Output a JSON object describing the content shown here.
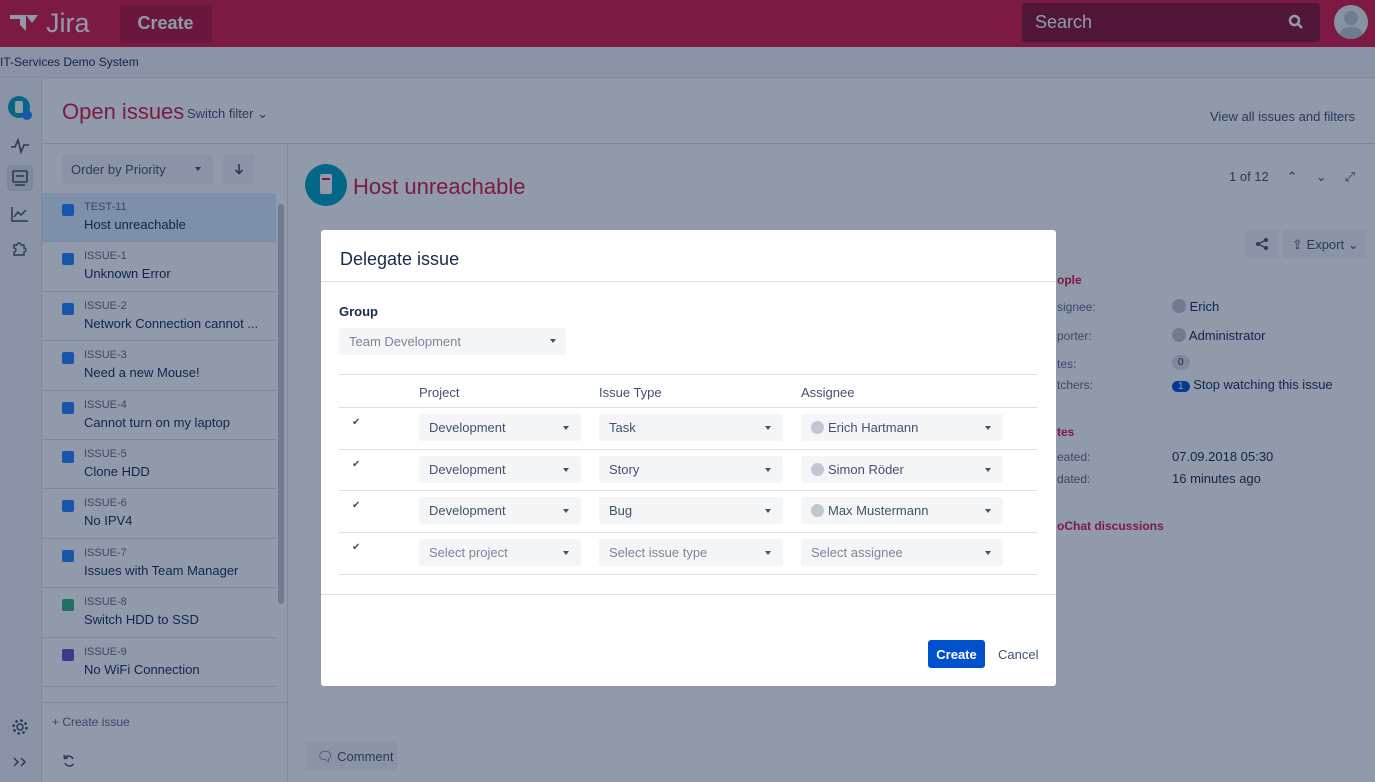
{
  "topbar": {
    "app_name": "Jira",
    "create_label": "Create",
    "search_placeholder": "Search"
  },
  "subbar": {
    "system_name": "IT-Services Demo System"
  },
  "header": {
    "title": "Open issues",
    "switch_filter": "Switch filter",
    "view_all": "View all issues and filters"
  },
  "list": {
    "order_label": "Order by Priority",
    "issues": [
      {
        "key": "TEST-11",
        "summary": "Host unreachable",
        "color": "#2684ff",
        "selected": true
      },
      {
        "key": "ISSUE-1",
        "summary": "Unknown Error",
        "color": "#2684ff"
      },
      {
        "key": "ISSUE-2",
        "summary": "Network Connection cannot ...",
        "color": "#2684ff"
      },
      {
        "key": "ISSUE-3",
        "summary": "Need a new Mouse!",
        "color": "#2684ff"
      },
      {
        "key": "ISSUE-4",
        "summary": "Cannot turn on my laptop",
        "color": "#2684ff"
      },
      {
        "key": "ISSUE-5",
        "summary": "Clone HDD",
        "color": "#2684ff"
      },
      {
        "key": "ISSUE-6",
        "summary": "No IPV4",
        "color": "#2684ff"
      },
      {
        "key": "ISSUE-7",
        "summary": "Issues with Team Manager",
        "color": "#2684ff"
      },
      {
        "key": "ISSUE-8",
        "summary": "Switch HDD to SSD",
        "color": "#36b37e"
      },
      {
        "key": "ISSUE-9",
        "summary": "No WiFi Connection",
        "color": "#6554c0"
      }
    ],
    "create_issue": "+ Create issue"
  },
  "detail": {
    "title": "Host unreachable",
    "paging": "1 of 12",
    "export_label": "Export",
    "people_heading": "ople",
    "assignee_label": "signee:",
    "assignee_value": "Erich",
    "reporter_label": "porter:",
    "reporter_value": "Administrator",
    "votes_label": "tes:",
    "votes_value": "0",
    "watchers_label": "tchers:",
    "watchers_count": "1",
    "watchers_value": "Stop watching this issue",
    "dates_heading": "tes",
    "created_label": "eated:",
    "created_value": "07.09.2018 05:30",
    "updated_label": "dated:",
    "updated_value": "16 minutes ago",
    "chat_heading": "oChat discussions",
    "comment_label": "Comment"
  },
  "dialog": {
    "title": "Delegate issue",
    "group_label": "Group",
    "group_value": "Team Development",
    "columns": {
      "project": "Project",
      "issue_type": "Issue Type",
      "assignee": "Assignee"
    },
    "rows": [
      {
        "checked": true,
        "project": "Development",
        "issue_type": "Task",
        "assignee": "Erich Hartmann"
      },
      {
        "checked": true,
        "project": "Development",
        "issue_type": "Story",
        "assignee": "Simon Röder"
      },
      {
        "checked": true,
        "project": "Development",
        "issue_type": "Bug",
        "assignee": "Max Mustermann"
      },
      {
        "checked": true,
        "project": "Select project",
        "issue_type": "Select issue type",
        "assignee": "Select assignee",
        "placeholder": true
      }
    ],
    "create_label": "Create",
    "cancel_label": "Cancel"
  }
}
